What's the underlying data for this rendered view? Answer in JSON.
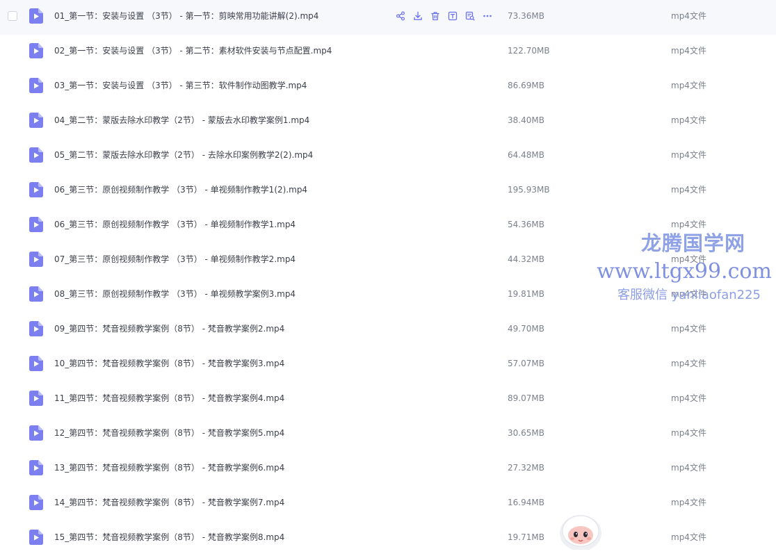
{
  "colors": {
    "accent": "#7b7ff0",
    "row_hover": "#f6f8fc",
    "watermark": "#8fa2e6"
  },
  "row_actions": [
    {
      "name": "share-icon"
    },
    {
      "name": "download-icon"
    },
    {
      "name": "delete-icon"
    },
    {
      "name": "text-extract-icon"
    },
    {
      "name": "image-search-icon"
    },
    {
      "name": "more-icon"
    }
  ],
  "files": [
    {
      "name": "01_第一节：安装与设置 （3节） - 第一节：剪映常用功能讲解(2).mp4",
      "size": "73.36MB",
      "type": "mp4文件"
    },
    {
      "name": "02_第一节：安装与设置 （3节） - 第二节：素材软件安装与节点配置.mp4",
      "size": "122.70MB",
      "type": "mp4文件"
    },
    {
      "name": "03_第一节：安装与设置 （3节） - 第三节：软件制作动图教学.mp4",
      "size": "86.69MB",
      "type": "mp4文件"
    },
    {
      "name": "04_第二节：蒙版去除水印教学（2节） - 蒙版去水印教学案例1.mp4",
      "size": "38.40MB",
      "type": "mp4文件"
    },
    {
      "name": "05_第二节：蒙版去除水印教学（2节） - 去除水印案例教学2(2).mp4",
      "size": "64.48MB",
      "type": "mp4文件"
    },
    {
      "name": "06_第三节：原创视频制作教学 （3节） - 单视频制作教学1(2).mp4",
      "size": "195.93MB",
      "type": "mp4文件"
    },
    {
      "name": "06_第三节：原创视频制作教学 （3节） - 单视频制作教学1.mp4",
      "size": "54.36MB",
      "type": "mp4文件"
    },
    {
      "name": "07_第三节：原创视频制作教学 （3节） - 单视频制作教学2.mp4",
      "size": "44.32MB",
      "type": "mp4文件"
    },
    {
      "name": "08_第三节：原创视频制作教学 （3节） - 单视频教学案例3.mp4",
      "size": "19.81MB",
      "type": "mp4文件"
    },
    {
      "name": "09_第四节：梵音视频教学案例（8节） - 梵音教学案例2.mp4",
      "size": "49.70MB",
      "type": "mp4文件"
    },
    {
      "name": "10_第四节：梵音视频教学案例（8节） - 梵音教学案例3.mp4",
      "size": "57.07MB",
      "type": "mp4文件"
    },
    {
      "name": "11_第四节：梵音视频教学案例（8节） - 梵音教学案例4.mp4",
      "size": "89.07MB",
      "type": "mp4文件"
    },
    {
      "name": "12_第四节：梵音视频教学案例（8节） - 梵音教学案例5.mp4",
      "size": "30.65MB",
      "type": "mp4文件"
    },
    {
      "name": "13_第四节：梵音视频教学案例（8节） - 梵音教学案例6.mp4",
      "size": "27.32MB",
      "type": "mp4文件"
    },
    {
      "name": "14_第四节：梵音视频教学案例（8节） - 梵音教学案例7.mp4",
      "size": "16.94MB",
      "type": "mp4文件"
    },
    {
      "name": "15_第四节：梵音视频教学案例（8节） - 梵音教学案例8.mp4",
      "size": "19.71MB",
      "type": "mp4文件"
    }
  ],
  "watermark": {
    "title": "龙腾国学网",
    "url": "www.ltgx99.com",
    "contact": "客服微信 yanliaofan225"
  }
}
